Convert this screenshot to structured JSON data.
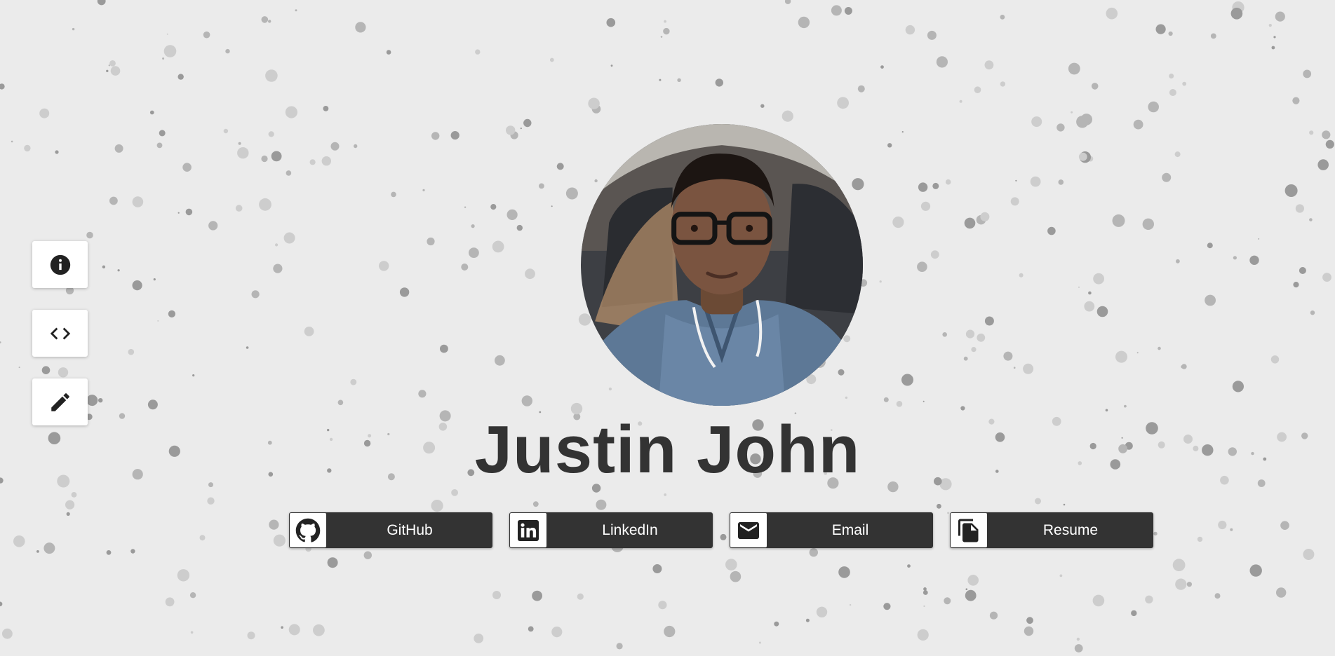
{
  "profile": {
    "name": "Justin John",
    "avatar_alt": "Justin John"
  },
  "sidebar": {
    "items": [
      {
        "icon": "info-icon"
      },
      {
        "icon": "code-icon"
      },
      {
        "icon": "pencil-icon"
      }
    ]
  },
  "links": [
    {
      "label": "GitHub",
      "icon": "github-icon"
    },
    {
      "label": "LinkedIn",
      "icon": "linkedin-icon"
    },
    {
      "label": "Email",
      "icon": "email-icon"
    },
    {
      "label": "Resume",
      "icon": "document-icon"
    }
  ],
  "colors": {
    "background": "#ebebeb",
    "button": "#333333",
    "text": "#333333",
    "dots": [
      "#9a9a9a",
      "#b5b5b5",
      "#cdcdcd"
    ]
  }
}
